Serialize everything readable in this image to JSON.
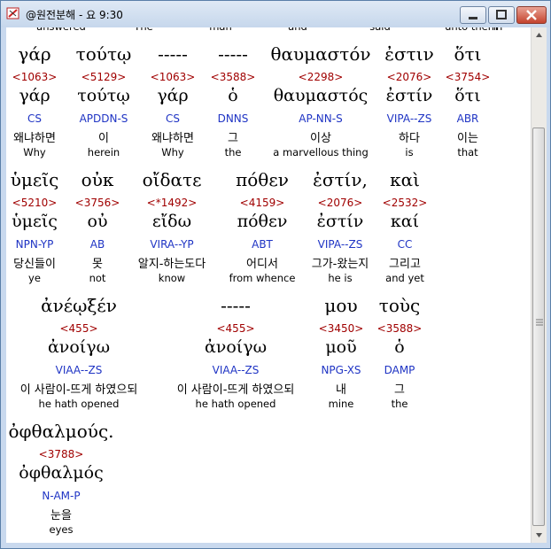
{
  "window": {
    "title": "@원전분해 - 요 9:30"
  },
  "top_partial": [
    "answered",
    "The",
    "man",
    "and",
    "said",
    "unto them",
    "in"
  ],
  "groups": [
    {
      "greek": [
        "γάρ",
        "τούτῳ",
        "-----",
        "-----",
        "θαυμαστόν",
        "ἐστιν",
        "ὅτι"
      ],
      "numbers": [
        "<1063>",
        "<5129>",
        "<1063>",
        "<3588>",
        "<2298>",
        "<2076>",
        "<3754>"
      ],
      "lemma": [
        "γάρ",
        "τούτῳ",
        "γάρ",
        "ὁ",
        "θαυμαστός",
        "ἐστίν",
        "ὅτι"
      ],
      "parse": [
        "CS",
        "APDDN-S",
        "CS",
        "DNNS",
        "AP-NN-S",
        "VIPA--ZS",
        "ABR"
      ],
      "korean": [
        "왜냐하면",
        "이",
        "왜냐하면",
        "그",
        "이상",
        "하다",
        "이는"
      ],
      "english": [
        "Why",
        "herein",
        "Why",
        "the",
        "a marvellous thing",
        "is",
        "that"
      ]
    },
    {
      "greek": [
        "ὑμεῖς",
        "οὐκ",
        "οἴδατε",
        "πόθεν",
        "ἐστίν,",
        "καὶ"
      ],
      "numbers": [
        "<5210>",
        "<3756>",
        "<*1492>",
        "<4159>",
        "<2076>",
        "<2532>"
      ],
      "lemma": [
        "ὑμεῖς",
        "οὐ",
        "εἴδω",
        "πόθεν",
        "ἐστίν",
        "καί"
      ],
      "parse": [
        "NPN-YP",
        "AB",
        "VIRA--YP",
        "ABT",
        "VIPA--ZS",
        "CC"
      ],
      "korean": [
        "당신들이",
        "못",
        "알지-하는도다",
        "어디서",
        "그가-왔는지",
        "그리고"
      ],
      "english": [
        "ye",
        "not",
        "know",
        "from whence",
        "he is",
        "and yet"
      ]
    },
    {
      "greek": [
        "ἀνέῳξέν",
        "-----",
        "μου",
        "τοὺς"
      ],
      "numbers": [
        "<455>",
        "<455>",
        "<3450>",
        "<3588>"
      ],
      "lemma": [
        "ἀνοίγω",
        "ἀνοίγω",
        "μοῦ",
        "ὁ"
      ],
      "parse": [
        "VIAA--ZS",
        "VIAA--ZS",
        "NPG-XS",
        "DAMP"
      ],
      "korean": [
        "이 사람이-뜨게 하였으되",
        "이 사람이-뜨게 하였으되",
        "내",
        "그"
      ],
      "english": [
        "he hath opened",
        "he hath opened",
        "mine",
        "the"
      ]
    },
    {
      "greek": [
        "ὀφθαλμούς."
      ],
      "numbers": [
        "<3788>"
      ],
      "lemma": [
        "ὀφθαλμός"
      ],
      "parse": [
        "N-AM-P"
      ],
      "korean": [
        "눈을"
      ],
      "english": [
        "eyes"
      ]
    }
  ],
  "colors": {
    "numbers": "#a00000",
    "parse": "#1f34c4",
    "text": "#000000"
  }
}
